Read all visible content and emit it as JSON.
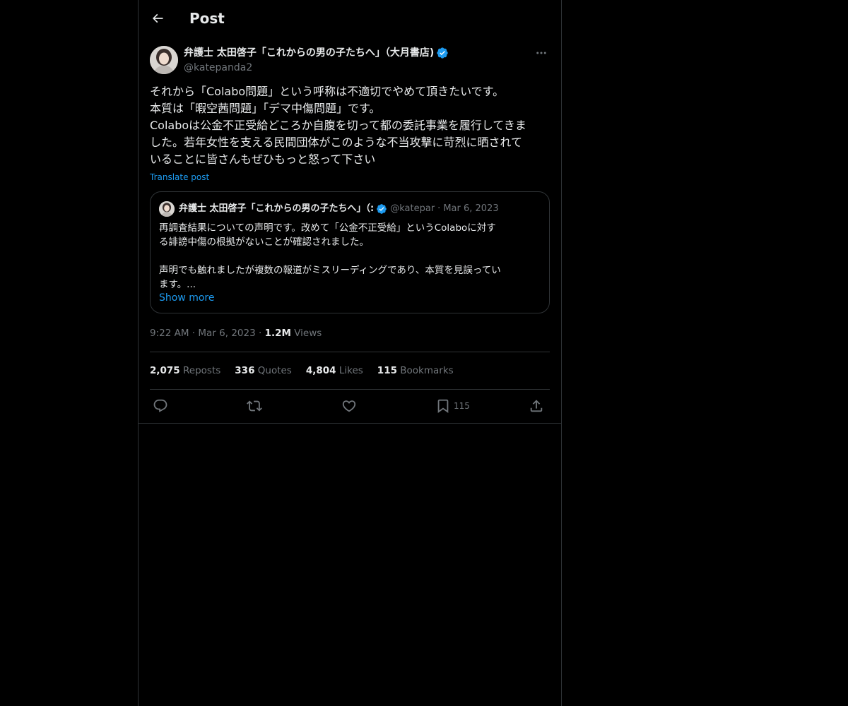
{
  "header": {
    "title": "Post"
  },
  "author": {
    "name": "弁護士 太田啓子「これからの男の子たちへ」（大月書店)",
    "handle": "@katepanda2"
  },
  "post": {
    "lines": [
      "それから「Colabo問題」という呼称は不適切でやめて頂きたいです。",
      "本質は「暇空茜問題」「デマ中傷問題」です。",
      "Colaboは公金不正受給どころか自腹を切って都の委託事業を履行してきま",
      "した。若年女性を支える民間団体がこのような不当攻撃に苛烈に晒されて",
      "いることに皆さんもぜひもっと怒って下さい"
    ],
    "translate_label": "Translate post"
  },
  "quote": {
    "name": "弁護士 太田啓子「これからの男の子たちへ」（:",
    "handle": "@katepar",
    "separator": "·",
    "date": "Mar 6, 2023",
    "lines": [
      "再調査結果についての声明です。改めて「公金不正受給」というColaboに対す",
      "る誹謗中傷の根拠がないことが確認されました。",
      "",
      "声明でも触れましたが複数の報道がミスリーディングであり、本質を見誤ってい",
      "ます。..."
    ],
    "show_more": "Show more"
  },
  "meta": {
    "time": "9:22 AM",
    "separator": "·",
    "date": "Mar 6, 2023",
    "views_count": "1.2M",
    "views_label": "Views"
  },
  "stats": {
    "reposts_count": "2,075",
    "reposts_label": "Reposts",
    "quotes_count": "336",
    "quotes_label": "Quotes",
    "likes_count": "4,804",
    "likes_label": "Likes",
    "bookmarks_count": "115",
    "bookmarks_label": "Bookmarks"
  },
  "actions": {
    "bookmark_count": "115"
  },
  "icons": {
    "back": "arrow-left-icon",
    "verified": "verified-badge-icon",
    "more": "more-horizontal-icon",
    "reply": "reply-icon",
    "repost": "repost-icon",
    "like": "heart-icon",
    "bookmark": "bookmark-icon",
    "share": "share-icon"
  },
  "colors": {
    "background": "#000000",
    "text": "#e7e9ea",
    "muted": "#71767b",
    "accent": "#1d9bf0",
    "border": "#2f3336"
  }
}
